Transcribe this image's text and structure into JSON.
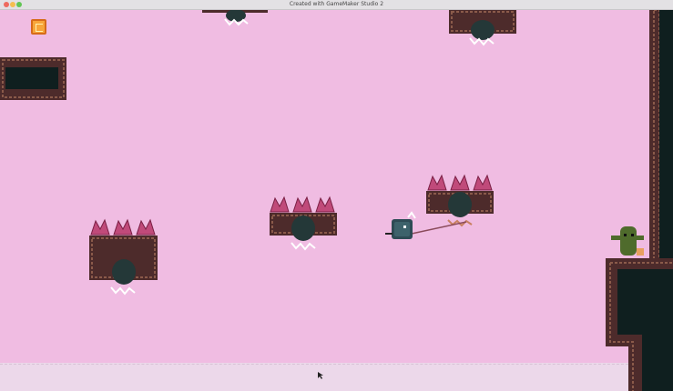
{
  "window": {
    "title": "Created with GameMaker Studio 2"
  },
  "colors": {
    "sky": "#f0bce2",
    "brick": "#4d2b2b",
    "brick_trim": "#8a5a4a",
    "dark_fill": "#0f1f1f",
    "enemy_green": "#4f6b2c",
    "spike_pink": "#c04a7a",
    "player_body": "#2e4b55"
  },
  "icons": {
    "coin": "coin-icon",
    "player": "player-sprite",
    "enemy": "cactus-enemy",
    "cursor": "mouse-cursor"
  }
}
